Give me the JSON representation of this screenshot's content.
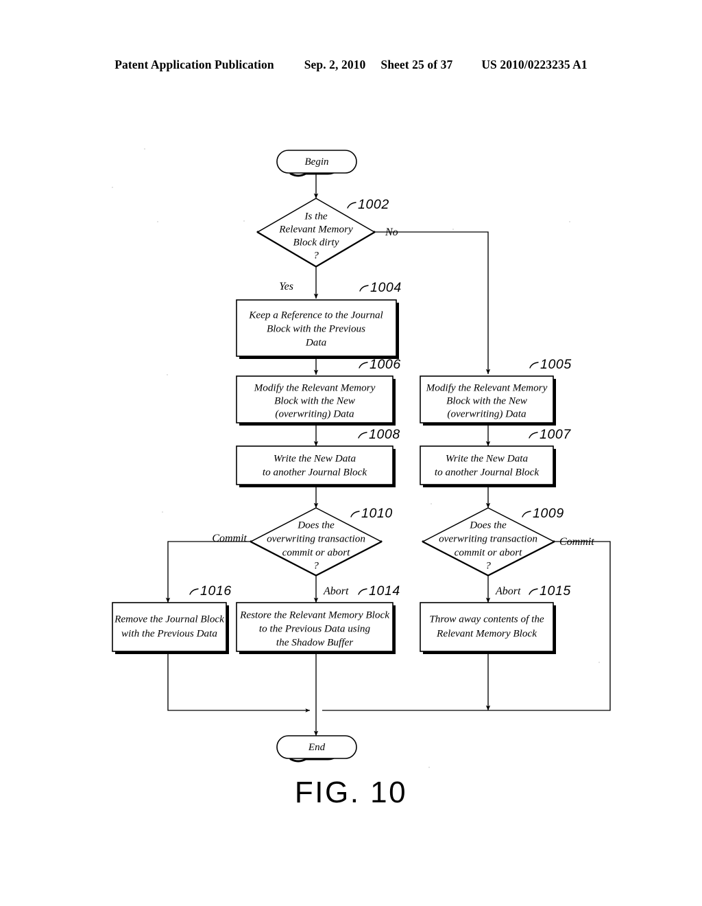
{
  "header": {
    "publication": "Patent Application Publication",
    "date": "Sep. 2, 2010",
    "sheet": "Sheet 25 of 37",
    "patent_number": "US 2010/0223235 A1"
  },
  "figure": {
    "caption": "FIG. 10",
    "type": "flowchart"
  },
  "flowchart": {
    "nodes": {
      "begin": {
        "label": "Begin",
        "shape": "terminal"
      },
      "end": {
        "label": "End",
        "shape": "terminal"
      },
      "d1002": {
        "ref": "1002",
        "shape": "decision",
        "lines": [
          "Is the",
          "Relevant Memory",
          "Block dirty",
          "?"
        ]
      },
      "b1004": {
        "ref": "1004",
        "shape": "process",
        "lines": [
          "Keep a Reference to the Journal",
          "Block with the Previous",
          "Data"
        ]
      },
      "b1006": {
        "ref": "1006",
        "shape": "process",
        "lines": [
          "Modify the Relevant Memory",
          "Block with the New",
          "(overwriting) Data"
        ]
      },
      "b1005": {
        "ref": "1005",
        "shape": "process",
        "lines": [
          "Modify the Relevant Memory",
          "Block with the New",
          "(overwriting) Data"
        ]
      },
      "b1008": {
        "ref": "1008",
        "shape": "process",
        "lines": [
          "Write the New Data",
          "to another Journal Block"
        ]
      },
      "b1007": {
        "ref": "1007",
        "shape": "process",
        "lines": [
          "Write the New Data",
          "to another Journal Block"
        ]
      },
      "d1010": {
        "ref": "1010",
        "shape": "decision",
        "lines": [
          "Does the",
          "overwriting transaction",
          "commit or abort",
          "?"
        ]
      },
      "d1009": {
        "ref": "1009",
        "shape": "decision",
        "lines": [
          "Does the",
          "overwriting transaction",
          "commit or abort",
          "?"
        ]
      },
      "b1016": {
        "ref": "1016",
        "shape": "process",
        "lines": [
          "Remove the Journal Block",
          "with the Previous Data"
        ]
      },
      "b1014": {
        "ref": "1014",
        "shape": "process",
        "lines": [
          "Restore the Relevant Memory Block",
          "to the Previous Data using",
          "the Shadow Buffer"
        ]
      },
      "b1015": {
        "ref": "1015",
        "shape": "process",
        "lines": [
          "Throw away contents of the",
          "Relevant Memory Block"
        ]
      }
    },
    "edge_labels": {
      "yes": "Yes",
      "no": "No",
      "commit_left": "Commit",
      "commit_right": "Commit",
      "abort_left": "Abort",
      "abort_right": "Abort"
    }
  },
  "colors": {
    "ink": "#000000",
    "paper": "#ffffff"
  }
}
